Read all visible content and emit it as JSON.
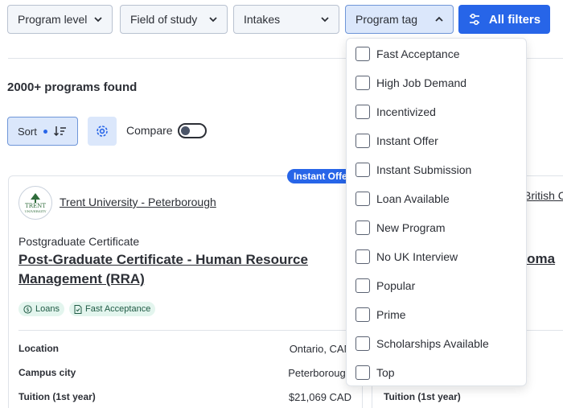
{
  "filters": {
    "program_level": "Program level",
    "field_of_study": "Field of study",
    "intakes": "Intakes",
    "program_tag": "Program tag",
    "all_filters": "All filters"
  },
  "results": {
    "count_text": "2000+ programs found",
    "sort_label": "Sort",
    "compare_label": "Compare",
    "compare_enabled": false
  },
  "cards": [
    {
      "badge": "Instant Offer",
      "logo_text": "TRENT",
      "logo_sub": "UNIVERSITY",
      "school": "Trent University - Peterborough",
      "level": "Postgraduate Certificate",
      "title": "Post-Graduate Certificate - Human Resource Management (RRA)",
      "tags": [
        {
          "icon": "dollar-icon",
          "label": "Loans"
        },
        {
          "icon": "document-icon",
          "label": "Fast Acceptance"
        }
      ],
      "details": [
        {
          "label": "Location",
          "value": "Ontario, CAN"
        },
        {
          "label": "Campus city",
          "value": "Peterborough"
        },
        {
          "label": "Tuition (1st year)",
          "value": "$21,069 CAD"
        }
      ]
    },
    {
      "school": "British C",
      "title": "oloma",
      "details": [
        {
          "label": "Tuition (1st year)"
        }
      ]
    }
  ],
  "program_tag_options": [
    "Fast Acceptance",
    "High Job Demand",
    "Incentivized",
    "Instant Offer",
    "Instant Submission",
    "Loan Available",
    "New Program",
    "No UK Interview",
    "Popular",
    "Prime",
    "Scholarships Available",
    "Top"
  ],
  "colors": {
    "accent": "#2765e8",
    "active_bg": "#dbe7fb",
    "tag_bg": "#e3f5ee"
  }
}
